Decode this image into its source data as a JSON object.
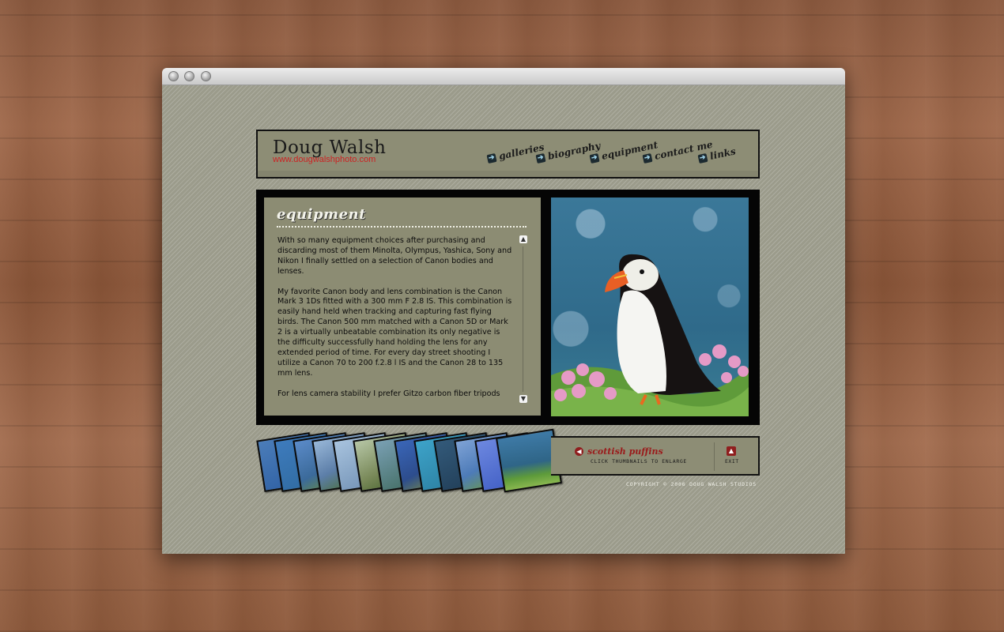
{
  "header": {
    "name": "Doug Walsh",
    "url": "www.dougwalshphoto.com"
  },
  "nav": {
    "items": [
      {
        "label": "galleries"
      },
      {
        "label": "biography"
      },
      {
        "label": "equipment"
      },
      {
        "label": "contact me"
      },
      {
        "label": "links"
      }
    ]
  },
  "section": {
    "title": "equipment",
    "paragraphs": [
      "With so many equipment choices after purchasing and discarding most of them Minolta, Olympus, Yashica, Sony and Nikon I finally settled on a selection of Canon bodies and lenses.",
      "My favorite Canon body and lens combination is the Canon Mark 3 1Ds fitted with a 300 mm F 2.8 IS.  This combination is easily hand held when tracking and capturing fast flying birds. The Canon 500 mm matched with a Canon 5D or Mark 2 is a virtually unbeatable combination its only negative is the difficulty successfully hand holding the lens for any extended period of time. For every day street shooting I utilize a Canon 70 to 200 f.2.8 l IS and the Canon 28 to 135 mm lens.",
      "For lens camera stability I prefer Gitzo carbon fiber tripods"
    ]
  },
  "gallery": {
    "caption": "scottish puffins",
    "hint": "CLICK THUMBNAILS TO ENLARGE",
    "exit": "EXIT"
  },
  "footer": {
    "copyright": "COPYRIGHT © 2006 DOUG WALSH STUDIOS"
  },
  "colors": {
    "accent": "#9a1b1b",
    "panel": "#8c8c73",
    "background": "#9b9b8b"
  }
}
